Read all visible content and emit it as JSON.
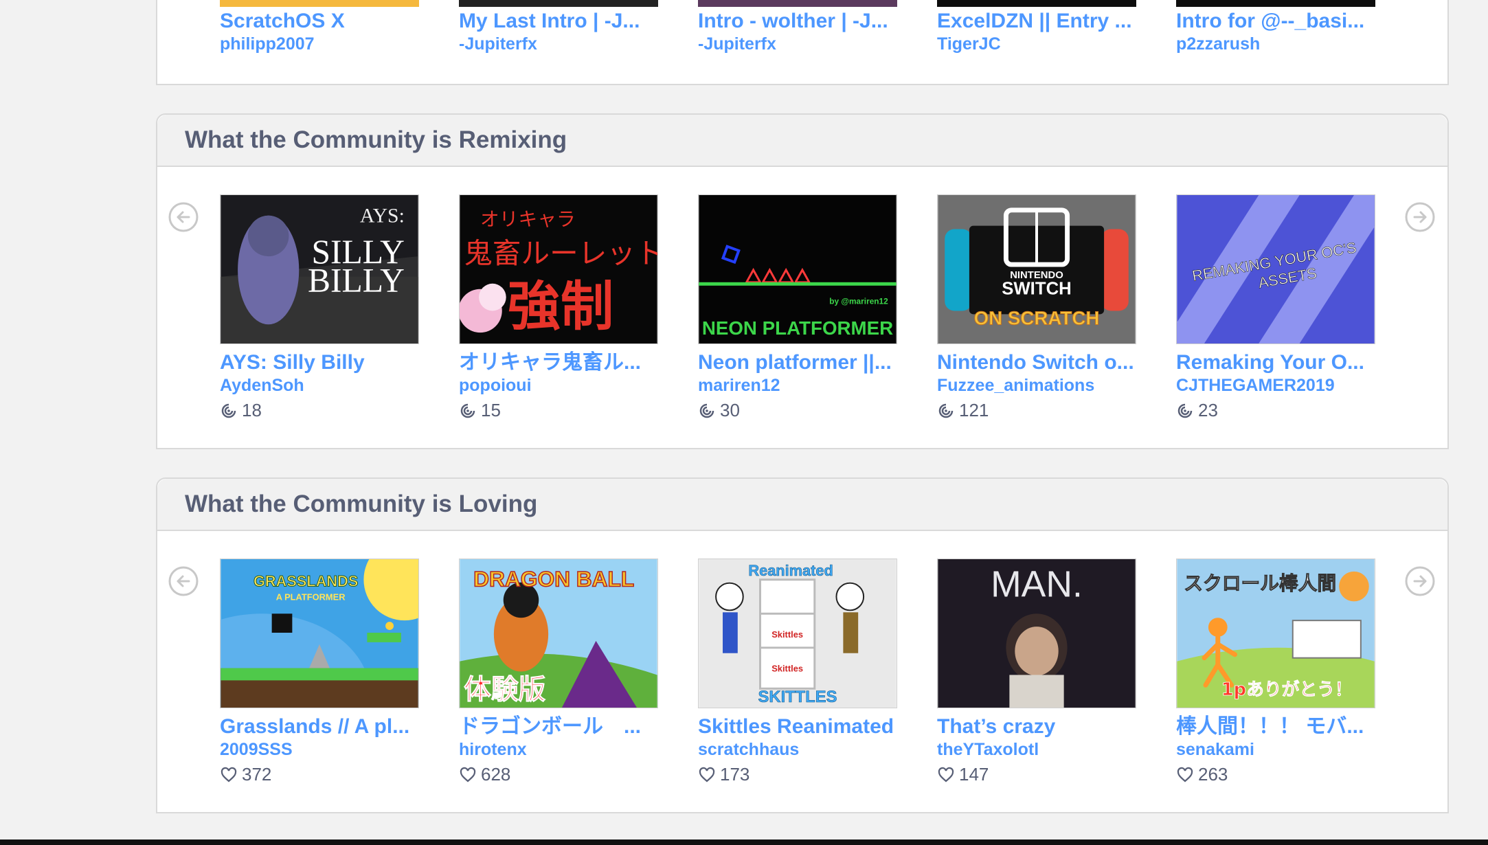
{
  "top_row": [
    {
      "title": "ScratchOS X",
      "author": "philipp2007",
      "strip": "#f5b83d"
    },
    {
      "title": "My Last Intro | -J...",
      "author": "-Jupiterfx",
      "strip": "#222222"
    },
    {
      "title": "Intro - wolther | -J...",
      "author": "-Jupiterfx",
      "strip": "#5b3a5e"
    },
    {
      "title": "ExcelDZN || Entry ...",
      "author": "TigerJC",
      "strip": "#0d0d0d"
    },
    {
      "title": "Intro for @--_basi...",
      "author": "p2zzarush",
      "strip": "#0d0d0d"
    }
  ],
  "remixing": {
    "title": "What the Community is Remixing",
    "projects": [
      {
        "title": "AYS: Silly Billy",
        "author": "AydenSoh",
        "count": "18",
        "thumb_text": [
          "AYS:",
          "SILLY",
          "BILLY"
        ]
      },
      {
        "title": "オリキャラ鬼畜ル...",
        "author": "popoioui",
        "count": "15",
        "thumb_text": [
          "オリキャラ",
          "鬼畜ルーレット",
          "強制"
        ]
      },
      {
        "title": "Neon platformer ||...",
        "author": "mariren12",
        "count": "30",
        "thumb_text": [
          "NEON PLATFORMER",
          "by @mariren12"
        ]
      },
      {
        "title": "Nintendo Switch o...",
        "author": "Fuzzee_animations",
        "count": "121",
        "thumb_text": [
          "NINTENDO",
          "SWITCH",
          "ON SCRATCH"
        ]
      },
      {
        "title": "Remaking Your O...",
        "author": "CJTHEGAMER2019",
        "count": "23",
        "thumb_text": [
          "REMAKING YOUR OC'S",
          "ASSETS"
        ]
      }
    ]
  },
  "loving": {
    "title": "What the Community is Loving",
    "projects": [
      {
        "title": "Grasslands // A pl...",
        "author": "2009SSS",
        "count": "372",
        "thumb_text": [
          "GRASSLANDS",
          "A PLATFORMER"
        ]
      },
      {
        "title": "ドラゴンボール　...",
        "author": "hirotenx",
        "count": "628",
        "thumb_text": [
          "DRAGON BALL",
          "体験版"
        ]
      },
      {
        "title": "Skittles Reanimated",
        "author": "scratchhaus",
        "count": "173",
        "thumb_text": [
          "Reanimated",
          "Skittles",
          "Skittles",
          "SKITTLES"
        ]
      },
      {
        "title": "That’s crazy",
        "author": "theYTaxolotl",
        "count": "147",
        "thumb_text": [
          "MAN."
        ]
      },
      {
        "title": "棒人間！！！ モバ...",
        "author": "senakami",
        "count": "263",
        "thumb_text": [
          "スクロール棒人間",
          "1pありがとう！"
        ]
      }
    ]
  },
  "icons": {
    "remix": "remix-icon",
    "love": "heart-icon",
    "prev": "arrow-left-icon",
    "next": "arrow-right-icon"
  }
}
